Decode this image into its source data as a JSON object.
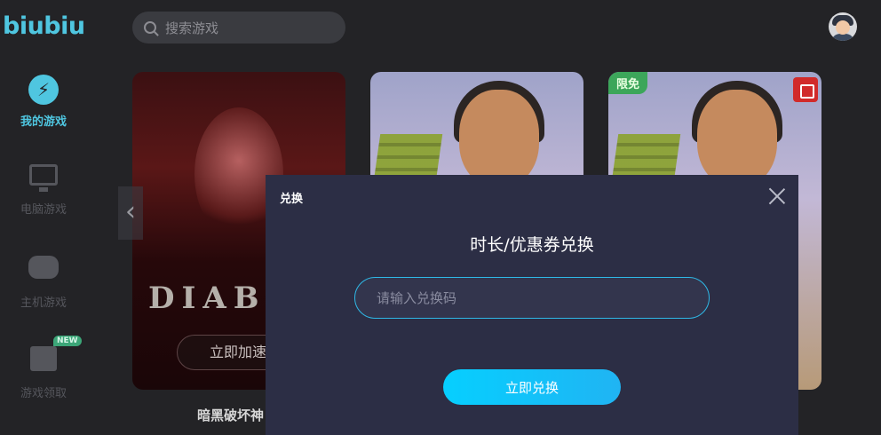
{
  "app": {
    "logo": "biubiu"
  },
  "search": {
    "placeholder": "搜索游戏"
  },
  "sidebar": {
    "items": [
      {
        "label": "我的游戏",
        "icon": "lightning-icon",
        "active": true
      },
      {
        "label": "电脑游戏",
        "icon": "monitor-icon"
      },
      {
        "label": "主机游戏",
        "icon": "gamepad-icon"
      },
      {
        "label": "游戏领取",
        "icon": "gift-icon",
        "badge": "NEW"
      }
    ]
  },
  "games": [
    {
      "title_art": "DIAB",
      "action": "立即加速",
      "name": "暗黑破坏神"
    },
    {},
    {
      "badge": "限免"
    }
  ],
  "modal": {
    "header": "兑换",
    "title": "时长/优惠券兑换",
    "input_placeholder": "请输入兑换码",
    "button": "立即兑换"
  },
  "colors": {
    "accent": "#4fc6e0",
    "button_start": "#06cfff",
    "button_end": "#20b4f3",
    "modal_bg": "#2c2e45",
    "free_badge": "#3ca65a"
  }
}
